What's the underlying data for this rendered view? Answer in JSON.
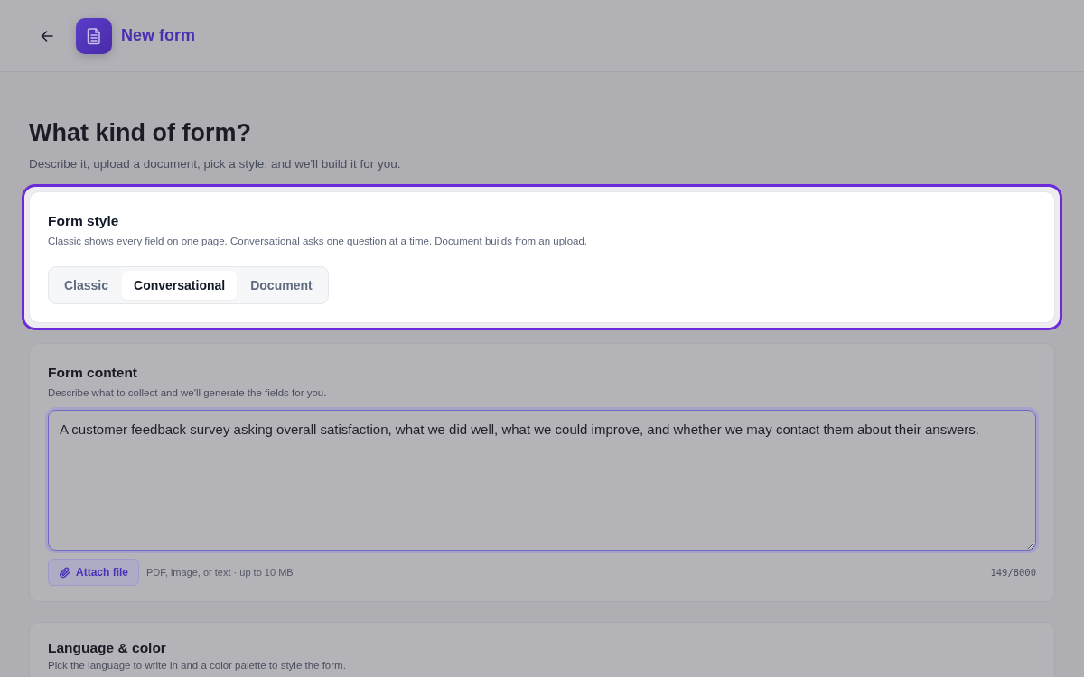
{
  "header": {
    "title": "New form"
  },
  "intro": {
    "heading": "What kind of form?",
    "subtitle": "Describe it, upload a document, pick a style, and we'll build it for you."
  },
  "sections": [
    {
      "kind": "style",
      "highlighted": true,
      "title": "Form style",
      "description": "Classic shows every field on one page. Conversational asks one question at a time. Document builds from an upload.",
      "options": [
        {
          "label": "Classic",
          "selected": false
        },
        {
          "label": "Conversational",
          "selected": true
        },
        {
          "label": "Document",
          "selected": false
        }
      ]
    },
    {
      "kind": "content",
      "highlighted": false,
      "title": "Form content",
      "description": "Describe what to collect and we'll generate the fields for you.",
      "field": {
        "value": "A customer feedback survey asking overall satisfaction, what we did well, what we could improve, and whether we may contact them about their answers.",
        "focused": true
      },
      "attach_button": "Attach file",
      "attach_hint": "PDF, image, or text · up to 10 MB",
      "counter": "149/8000"
    },
    {
      "kind": "settings",
      "highlighted": false,
      "title": "Language & color",
      "description": "Pick the language to write in and a color palette to style the form."
    }
  ]
}
